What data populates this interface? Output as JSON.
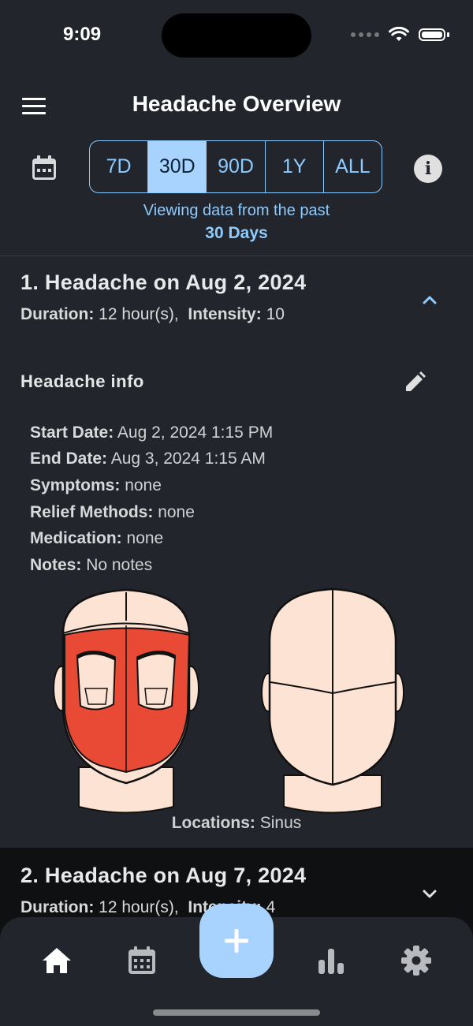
{
  "status": {
    "time": "9:09"
  },
  "header": {
    "title": "Headache Overview",
    "ranges": [
      "7D",
      "30D",
      "90D",
      "1Y",
      "ALL"
    ],
    "active_range": "30D",
    "viewing_text": "Viewing data from the past",
    "viewing_period": "30 Days"
  },
  "entries": [
    {
      "title": "1. Headache on Aug 2, 2024",
      "duration_label": "Duration:",
      "duration_value": "12 hour(s),",
      "intensity_label": "Intensity:",
      "intensity_value": "10",
      "expanded": true,
      "info_title": "Headache info",
      "details": [
        {
          "label": "Start Date:",
          "value": "Aug 2, 2024 1:15 PM"
        },
        {
          "label": "End Date:",
          "value": "Aug 3, 2024 1:15 AM"
        },
        {
          "label": "Symptoms:",
          "value": "none"
        },
        {
          "label": "Relief Methods:",
          "value": "none"
        },
        {
          "label": "Medication:",
          "value": "none"
        },
        {
          "label": "Notes:",
          "value": "No notes"
        }
      ],
      "locations_label": "Locations:",
      "locations_value": "Sinus"
    },
    {
      "title": "2. Headache on Aug 7, 2024",
      "duration_label": "Duration:",
      "duration_value": "12 hour(s),",
      "intensity_label": "Intensity:",
      "intensity_value": "4",
      "expanded": false
    }
  ],
  "nav": {
    "items": [
      "home-icon",
      "calendar-icon",
      "add-icon",
      "bar-chart-icon",
      "gear-icon"
    ],
    "active": "home"
  },
  "colors": {
    "accent": "#a8d3ff",
    "surface": "#22252b",
    "background": "#0f1011",
    "highlight_region": "#e84a35",
    "skin": "#fde3d3"
  }
}
